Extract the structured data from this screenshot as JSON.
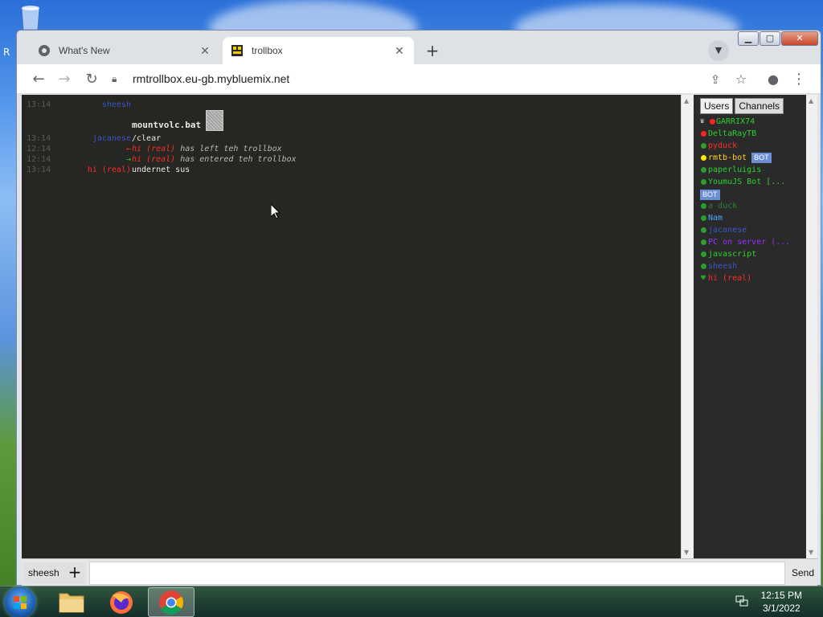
{
  "browser": {
    "tabs": [
      {
        "label": "What's New",
        "favicon": "chrome-icon"
      },
      {
        "label": "trollbox",
        "favicon": "trollbox-favicon"
      }
    ],
    "url": "rmtrollbox.eu-gb.mybluemix.net"
  },
  "chat": {
    "messages": [
      {
        "time": "13:14",
        "nick": "sheesh",
        "nick_color": "#3a56c8",
        "text": ""
      },
      {
        "time": "",
        "nick": "",
        "nick_color": "#e8e8e8",
        "text": "mountvolc.bat",
        "bold": true
      },
      {
        "time": "13:14",
        "nick": "jacanese",
        "nick_color": "#3a56c8",
        "text": "/clear"
      },
      {
        "time": "12:14",
        "nick": "←",
        "nick_color": "#ff2b2b",
        "user": "hi (real)",
        "text": " has left teh trollbox",
        "system": true
      },
      {
        "time": "12:14",
        "nick": "→",
        "nick_color": "#29d229",
        "user": "hi (real)",
        "text": " has entered teh trollbox",
        "system": true
      },
      {
        "time": "13:14",
        "nick": "hi (real)",
        "nick_color": "#ff2b2b",
        "text": "undernet sus"
      }
    ]
  },
  "sidebar": {
    "tabs": [
      "Users",
      "Channels"
    ],
    "users": [
      {
        "name": "GARRIX74",
        "color": "#2cd02c",
        "dot": "#ff2020",
        "crown": true
      },
      {
        "name": "DeltaRayTB",
        "color": "#2cd02c",
        "dot": "#ff2020"
      },
      {
        "name": "pyduck",
        "color": "#ff2b2b",
        "dot": "#2aa02a"
      },
      {
        "name": "rmtb-bot",
        "color": "#ffd21a",
        "dot": "#ffe600",
        "badge": "BOT"
      },
      {
        "name": "paperluigis",
        "color": "#2cd02c",
        "dot": "#2aa02a"
      },
      {
        "name": "YoumuJS Bot [...",
        "color": "#2cd02c",
        "dot": "#2aa02a",
        "badge_below": "BOT"
      },
      {
        "name": "a duck",
        "color": "#2f7f2f",
        "dot": "#2aa02a"
      },
      {
        "name": "Nam",
        "color": "#4aa3ff",
        "dot": "#2aa02a"
      },
      {
        "name": "jacanese",
        "color": "#3a56c8",
        "dot": "#2aa02a"
      },
      {
        "name": "PC on server (...",
        "color": "#9b2cff",
        "dot": "#2aa02a"
      },
      {
        "name": "javascript",
        "color": "#2cd02c",
        "dot": "#2aa02a"
      },
      {
        "name": "sheesh",
        "color": "#3a56c8",
        "dot": "#2aa02a"
      },
      {
        "name": "hi (real)",
        "color": "#ff2b2b",
        "dot": "#2aa02a",
        "heart": true
      }
    ]
  },
  "input": {
    "nick": "sheesh",
    "add_label": "+",
    "send_label": "Send"
  },
  "taskbar": {
    "time": "12:15 PM",
    "date": "3/1/2022"
  },
  "desktop": {
    "partial_label": "R"
  }
}
